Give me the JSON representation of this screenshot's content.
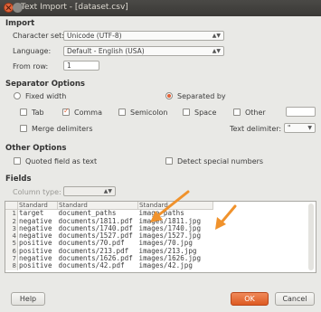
{
  "window": {
    "title": "Text Import - [dataset.csv]"
  },
  "import": {
    "heading": "Import",
    "charset_label": "Character set:",
    "charset_value": "Unicode (UTF-8)",
    "language_label": "Language:",
    "language_value": "Default - English (USA)",
    "from_row_label": "From row:",
    "from_row_value": "1"
  },
  "separator": {
    "heading": "Separator Options",
    "fixed_width": "Fixed width",
    "separated_by": "Separated by",
    "tab": "Tab",
    "comma": "Comma",
    "semicolon": "Semicolon",
    "space": "Space",
    "other": "Other",
    "merge": "Merge delimiters",
    "text_delim_label": "Text delimiter:",
    "text_delim_value": "\""
  },
  "other": {
    "heading": "Other Options",
    "quoted": "Quoted field as text",
    "detect": "Detect special numbers"
  },
  "fields": {
    "heading": "Fields",
    "column_type_label": "Column type:",
    "headers": [
      "Standard",
      "Standard",
      "Standard"
    ],
    "rows": [
      [
        "1",
        "target",
        "document_paths",
        "image_paths"
      ],
      [
        "2",
        "negative",
        "documents/1811.pdf",
        "images/1811.jpg"
      ],
      [
        "3",
        "negative",
        "documents/1740.pdf",
        "images/1740.jpg"
      ],
      [
        "4",
        "negative",
        "documents/1527.pdf",
        "images/1527.jpg"
      ],
      [
        "5",
        "positive",
        "documents/70.pdf",
        "images/70.jpg"
      ],
      [
        "6",
        "positive",
        "documents/213.pdf",
        "images/213.jpg"
      ],
      [
        "7",
        "negative",
        "documents/1626.pdf",
        "images/1626.jpg"
      ],
      [
        "8",
        "positive",
        "documents/42.pdf",
        "images/42.jpg"
      ]
    ]
  },
  "buttons": {
    "help": "Help",
    "ok": "OK",
    "cancel": "Cancel"
  },
  "colors": {
    "accent": "#e2653b",
    "arrow": "#f0922c"
  }
}
